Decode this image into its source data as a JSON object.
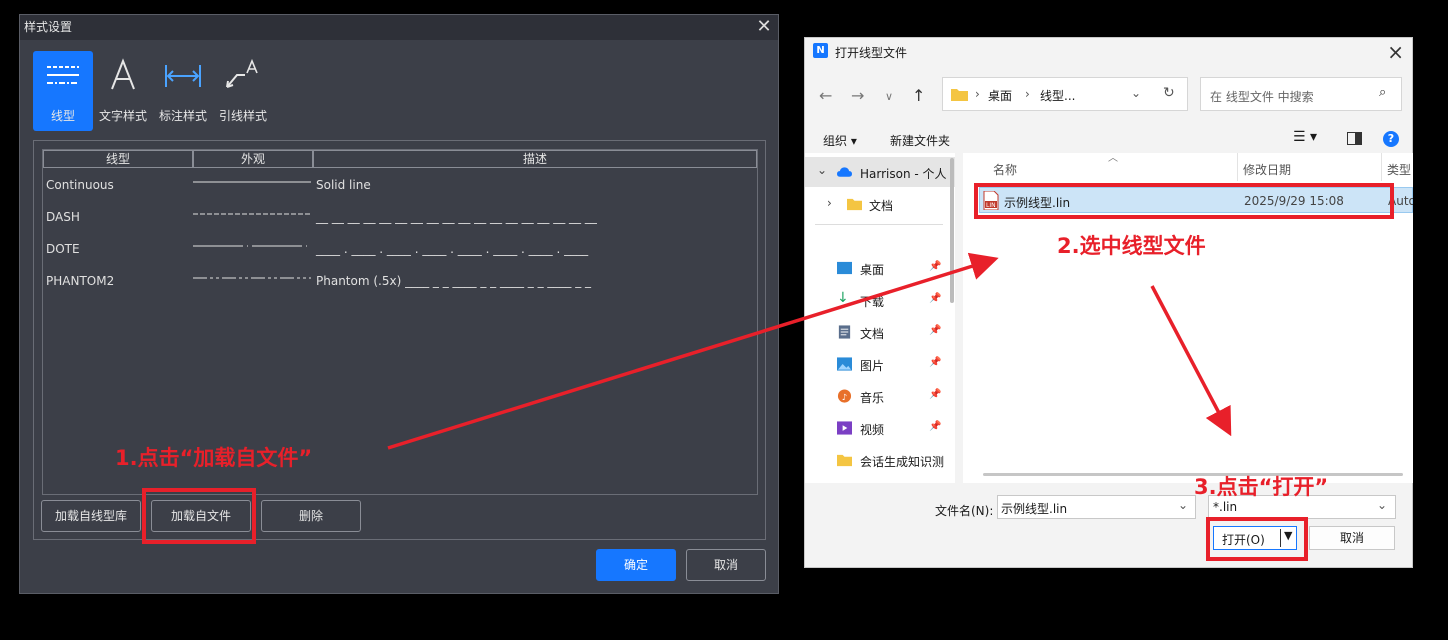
{
  "style_dialog": {
    "title": "样式设置",
    "tools": [
      {
        "label": "线型",
        "icon": "linetype-icon"
      },
      {
        "label": "文字样式",
        "icon": "text-style-icon"
      },
      {
        "label": "标注样式",
        "icon": "dimension-style-icon"
      },
      {
        "label": "引线样式",
        "icon": "leader-style-icon"
      }
    ],
    "columns": [
      "线型",
      "外观",
      "描述"
    ],
    "rows": [
      {
        "name": "Continuous",
        "desc": "Solid line"
      },
      {
        "name": "DASH",
        "desc": "__ __ __ __ __ __ __ __ __ __ __ __ __ __ __ __ __ __"
      },
      {
        "name": "DOTE",
        "desc": "____ . ____ . ____ . ____ . ____ . ____ . ____ . ____"
      },
      {
        "name": "PHANTOM2",
        "desc": "Phantom (.5x) ____ _ _ ____ _ _ ____ _ _ ____ _ _"
      }
    ],
    "buttons": {
      "load_library": "加载自线型库",
      "load_file": "加载自文件",
      "delete": "删除",
      "ok": "确定",
      "cancel": "取消"
    }
  },
  "file_dialog": {
    "title": "打开线型文件",
    "breadcrumb": [
      "桌面",
      "线型..."
    ],
    "search_placeholder": "在 线型文件 中搜索",
    "commands": {
      "organize": "组织 ▾",
      "new_folder": "新建文件夹"
    },
    "nav": [
      {
        "label": "Harrison - 个人",
        "icon": "onedrive-icon"
      },
      {
        "label": "文档",
        "icon": "folder-icon"
      },
      {
        "label": "桌面",
        "icon": "desktop-icon"
      },
      {
        "label": "下载",
        "icon": "download-icon"
      },
      {
        "label": "文档",
        "icon": "document-icon"
      },
      {
        "label": "图片",
        "icon": "pictures-icon"
      },
      {
        "label": "音乐",
        "icon": "music-icon"
      },
      {
        "label": "视频",
        "icon": "videos-icon"
      },
      {
        "label": "会话生成知识测",
        "icon": "folder-icon"
      }
    ],
    "columns": {
      "name": "名称",
      "modified": "修改日期",
      "type": "类型"
    },
    "file": {
      "name": "示例线型.lin",
      "modified": "2025/9/29 15:08",
      "type": "Auto"
    },
    "filename_label": "文件名(N):",
    "filename_value": "示例线型.lin",
    "filter": "*.lin",
    "open": "打开(O)",
    "cancel": "取消"
  },
  "annotations": {
    "step1": "1.点击“加载自文件”",
    "step2": "2.选中线型文件",
    "step3": "3.点击“打开”"
  },
  "colors": {
    "accent": "#1677ff",
    "annotation": "#e8202a"
  }
}
